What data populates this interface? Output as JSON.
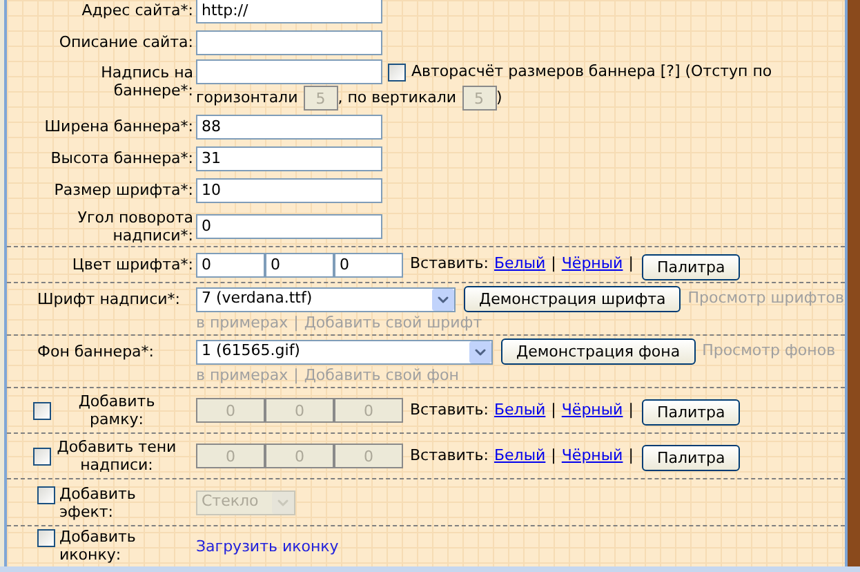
{
  "fields": [
    {
      "kind": "text",
      "label": "Адрес сайта*:",
      "value": "http://"
    },
    {
      "kind": "text",
      "label": "Описание сайта:"
    },
    {
      "kind": "caption",
      "label": "Надпись на баннере*:",
      "autosize": {
        "label": "Авторасчёт размеров баннера [?] (Отступ по",
        "checked": false
      },
      "h_label": "горизонтали",
      "h_value": "5",
      "v_label": ", по вертикали",
      "v_value": "5",
      "close": ")"
    },
    {
      "kind": "text",
      "label": "Ширена баннера*:",
      "value": "88"
    },
    {
      "kind": "text",
      "label": "Высота баннера*:",
      "value": "31"
    },
    {
      "kind": "text",
      "label": "Размер шрифта*:",
      "value": "10"
    },
    {
      "kind": "text",
      "label": "Угол поворота надписи*:",
      "value": "0"
    }
  ],
  "sections": [
    {
      "kind": "color",
      "label": "Цвет шрифта*:",
      "values": [
        "0",
        "0",
        "0"
      ],
      "insert": "Вставить:",
      "links": [
        "Белый",
        "Чёрный"
      ],
      "separators": [
        "|",
        "|"
      ],
      "button": "Палитра"
    },
    {
      "kind": "select",
      "label": "Шрифт надписи*:",
      "value": "7 (verdana.ttf)",
      "button": "Демонстрация шрифта",
      "preview": "Просмотр шрифтов",
      "more": "в примерах",
      "separator": "|",
      "add": "Добавить свой шрифт"
    },
    {
      "kind": "select",
      "label": "Фон баннера*:",
      "value": "1 (61565.gif)",
      "button": "Демонстрация фона",
      "preview": "Просмотр фонов",
      "more": "в примерах",
      "separator": "|",
      "add": "Добавить свой фон"
    },
    {
      "kind": "checkbox_color",
      "label": "Добавить рамку:",
      "checked": false,
      "values": [
        "0",
        "0",
        "0"
      ],
      "insert": "Вставить:",
      "links": [
        "Белый",
        "Чёрный"
      ],
      "separators": [
        "|",
        "|"
      ],
      "button": "Палитра"
    },
    {
      "kind": "checkbox_color",
      "label": "Добавить тени надписи:",
      "checked": false,
      "values": [
        "0",
        "0",
        "0"
      ],
      "insert": "Вставить:",
      "links": [
        "Белый",
        "Чёрный"
      ],
      "separators": [
        "|",
        "|"
      ],
      "button": "Палитра"
    },
    {
      "kind": "checkbox_select",
      "label": "Добавить эфект:",
      "checked": false,
      "value": "Стекло"
    },
    {
      "kind": "checkbox_link",
      "label": "Добавить иконку:",
      "checked": false,
      "link": "Загрузить иконку"
    }
  ]
}
